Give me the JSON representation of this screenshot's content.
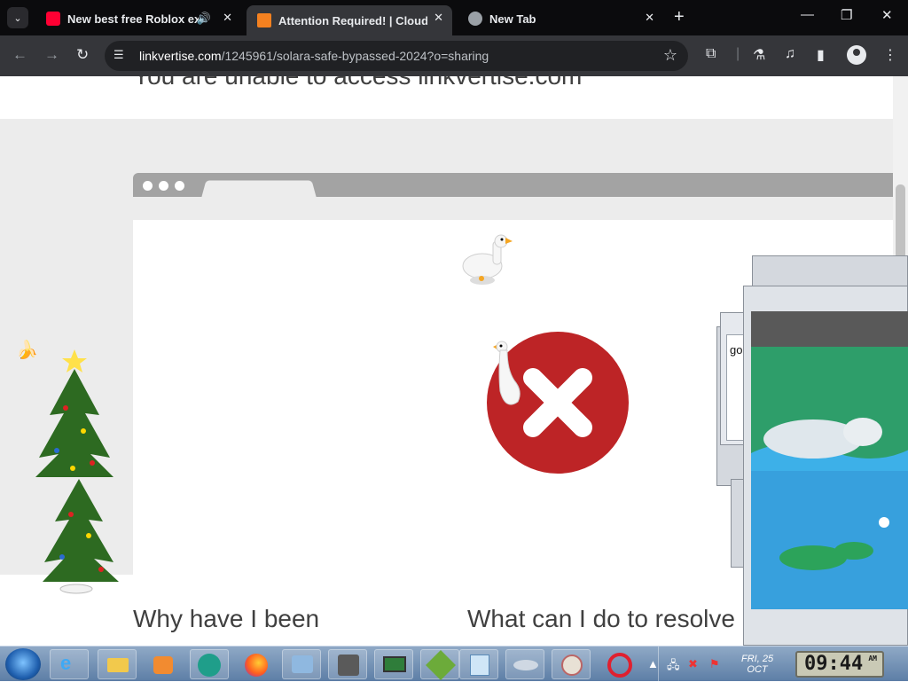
{
  "browser": {
    "tabs": [
      {
        "title": "New best free Roblox exec",
        "icon": "youtube-icon",
        "has_audio": true
      },
      {
        "title": "Attention Required! | Cloudflare",
        "icon": "cloudflare-icon",
        "active": true
      },
      {
        "title": "New Tab",
        "icon": "globe-icon"
      }
    ],
    "url_host": "linkvertise.com",
    "url_path": "/1245961/solara-safe-bypassed-2024?o=sharing"
  },
  "page": {
    "heading_cut": "You are unable to access linkvertise.com",
    "why_heading": "Why have I been",
    "what_heading": "What can I do to resolve"
  },
  "overlay": {
    "window_text": "go"
  },
  "taskbar": {
    "date_day": "FRI, 25",
    "date_month": "OCT",
    "clock": "09:44",
    "clock_ampm": "AM"
  },
  "colors": {
    "error_red": "#bd2426",
    "chrome_dark": "#35363a"
  }
}
